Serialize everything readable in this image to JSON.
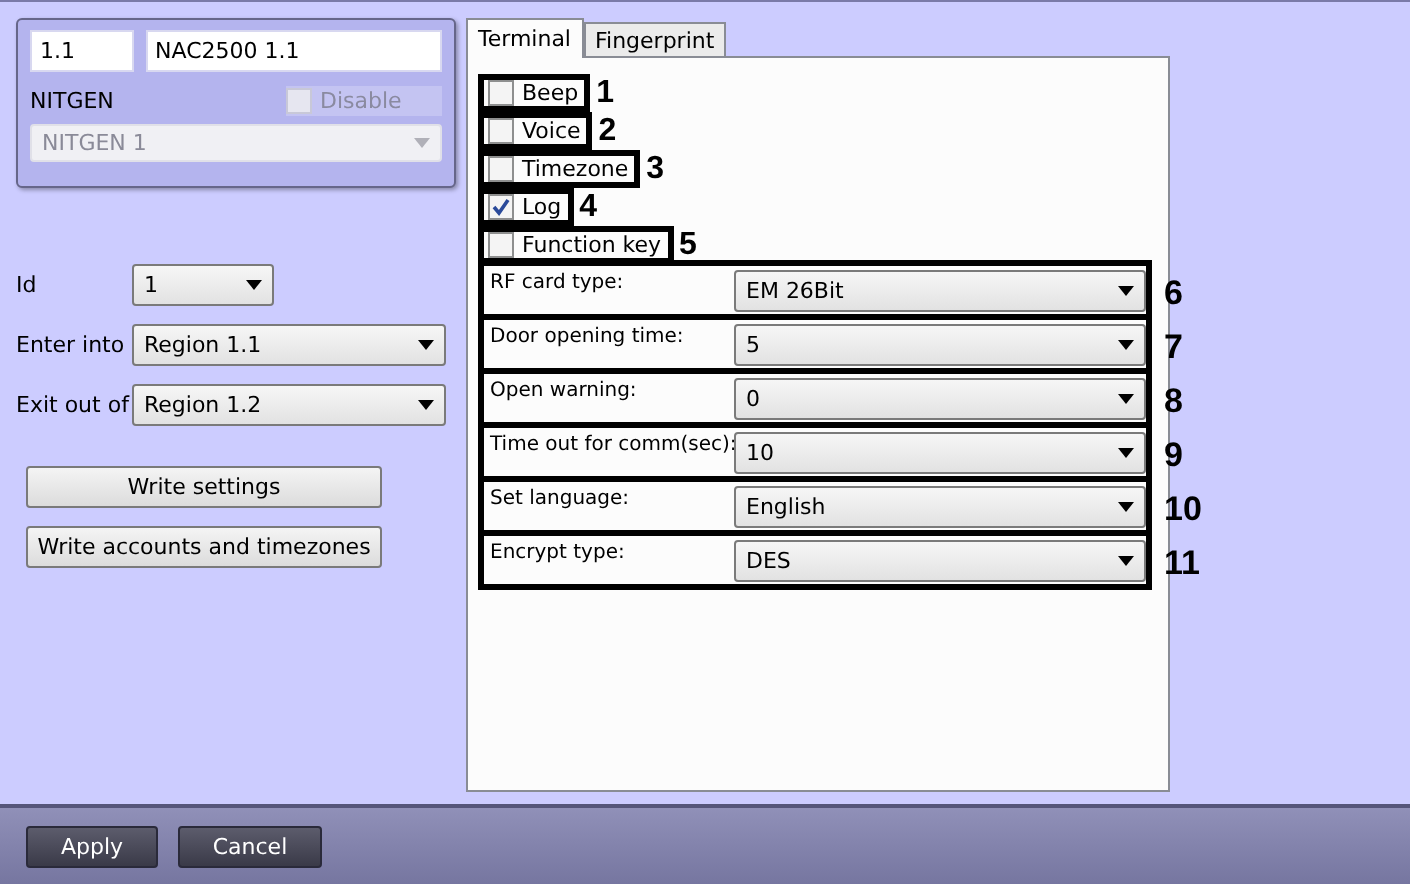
{
  "device": {
    "number": "1.1",
    "name": "NAC2500 1.1",
    "type_label": "NITGEN",
    "disable": {
      "label": "Disable",
      "checked": false,
      "disabled": true
    },
    "model": {
      "value": "NITGEN 1",
      "disabled": true
    }
  },
  "fields": [
    {
      "label": "Id",
      "value": "1",
      "kind": "short"
    },
    {
      "label": "Enter into",
      "value": "Region 1.1",
      "kind": "wide"
    },
    {
      "label": "Exit out of",
      "value": "Region 1.2",
      "kind": "wide"
    }
  ],
  "actions": [
    "Write settings",
    "Write accounts and timezones"
  ],
  "tabs": [
    {
      "label": "Terminal",
      "selected": true
    },
    {
      "label": "Fingerprint",
      "selected": false
    }
  ],
  "checkboxes": [
    {
      "label": "Beep",
      "checked": false,
      "number": "1"
    },
    {
      "label": "Voice",
      "checked": false,
      "number": "2"
    },
    {
      "label": "Timezone",
      "checked": false,
      "number": "3"
    },
    {
      "label": "Log",
      "checked": true,
      "number": "4"
    },
    {
      "label": "Function key",
      "checked": false,
      "number": "5"
    }
  ],
  "settings": [
    {
      "label": "RF card type:",
      "value": "EM 26Bit",
      "number": "6"
    },
    {
      "label": "Door opening time:",
      "value": "5",
      "number": "7"
    },
    {
      "label": "Open warning:",
      "value": "0",
      "number": "8"
    },
    {
      "label": "Time out for comm(sec):",
      "value": "10",
      "number": "9"
    },
    {
      "label": "Set language:",
      "value": "English",
      "number": "10"
    },
    {
      "label": "Encrypt type:",
      "value": "DES",
      "number": "11"
    }
  ],
  "buttons": [
    "Apply",
    "Cancel"
  ]
}
